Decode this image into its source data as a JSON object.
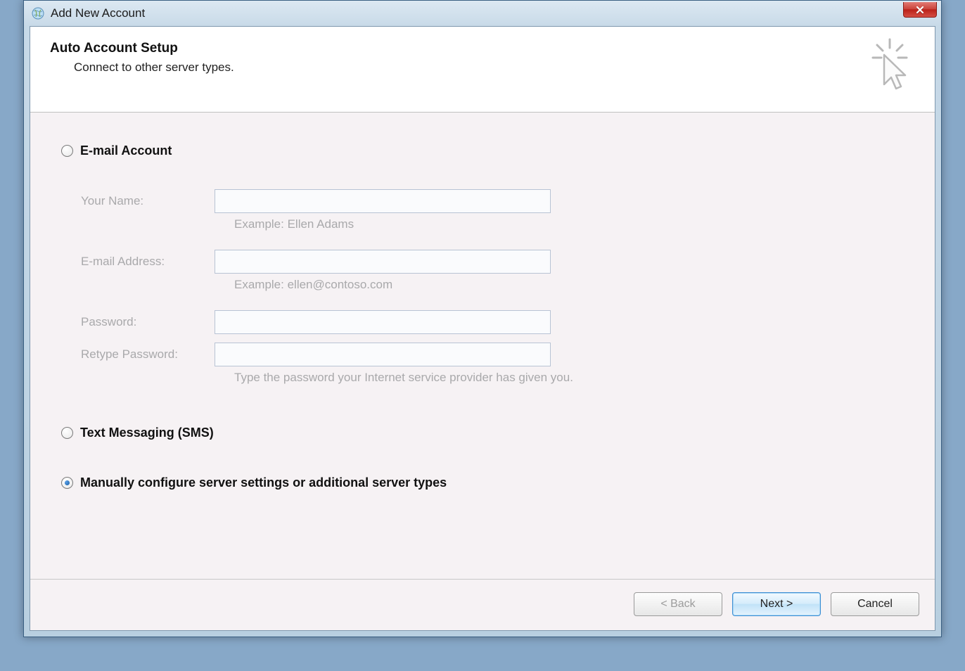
{
  "window": {
    "title": "Add New Account"
  },
  "header": {
    "title": "Auto Account Setup",
    "subtitle": "Connect to other server types."
  },
  "options": {
    "email": "E-mail Account",
    "sms": "Text Messaging (SMS)",
    "manual": "Manually configure server settings or additional server types"
  },
  "form": {
    "name_label": "Your Name:",
    "name_hint": "Example: Ellen Adams",
    "email_label": "E-mail Address:",
    "email_hint": "Example: ellen@contoso.com",
    "password_label": "Password:",
    "retype_label": "Retype Password:",
    "password_hint": "Type the password your Internet service provider has given you."
  },
  "footer": {
    "back": "< Back",
    "next": "Next >",
    "cancel": "Cancel"
  }
}
